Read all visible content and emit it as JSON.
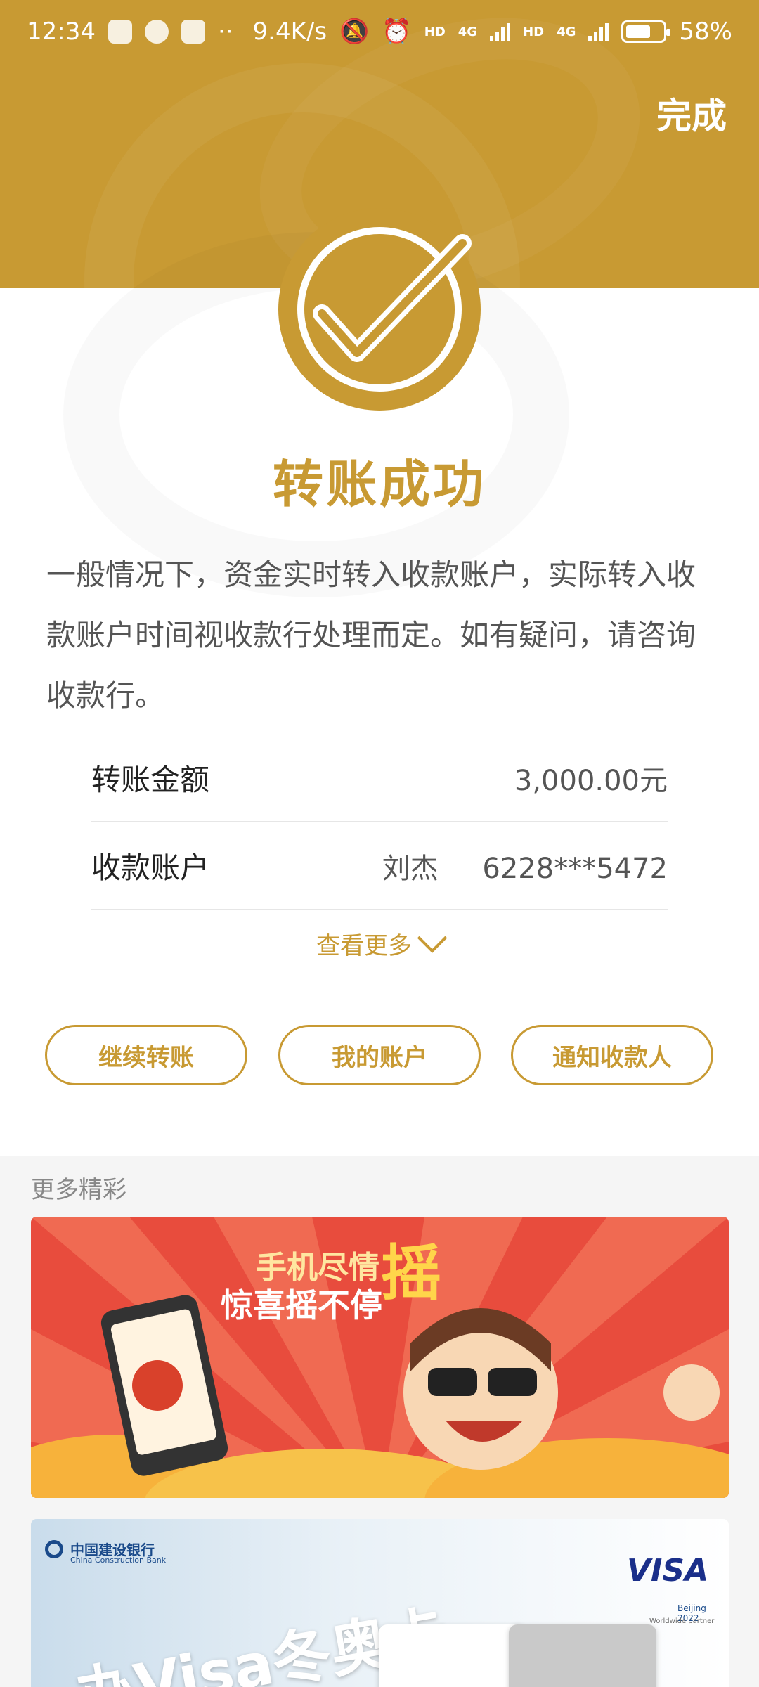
{
  "status_bar": {
    "time": "12:34",
    "net_speed": "9.4K/s",
    "hd_label": "HD",
    "sig_label": "4G",
    "battery": "58%"
  },
  "header": {
    "done_label": "完成"
  },
  "result": {
    "title": "转账成功",
    "description": "一般情况下，资金实时转入收款账户，实际转入收款账户时间视收款行处理而定。如有疑问，请咨询收款行。"
  },
  "details": {
    "amount_label": "转账金额",
    "amount_value": "3,000.00元",
    "payee_label": "收款账户",
    "payee_name": "刘杰",
    "payee_account": "6228***5472",
    "more_label": "查看更多"
  },
  "actions": {
    "continue_label": "继续转账",
    "my_account_label": "我的账户",
    "notify_label": "通知收款人"
  },
  "promo": {
    "section_title": "更多精彩",
    "banner1": {
      "line1": "手机尽情",
      "shake": "摇",
      "line2": "惊喜摇不停"
    },
    "banner2": {
      "bank_name": "中国建设银行",
      "bank_name_en": "China Construction Bank",
      "visa": "VISA",
      "slogan": "办Visa冬奥卡",
      "beijing": "Beijing 2022",
      "partner": "Worldwide partner"
    }
  },
  "colors": {
    "accent": "#c89a33",
    "banner_red": "#e84c3d"
  }
}
